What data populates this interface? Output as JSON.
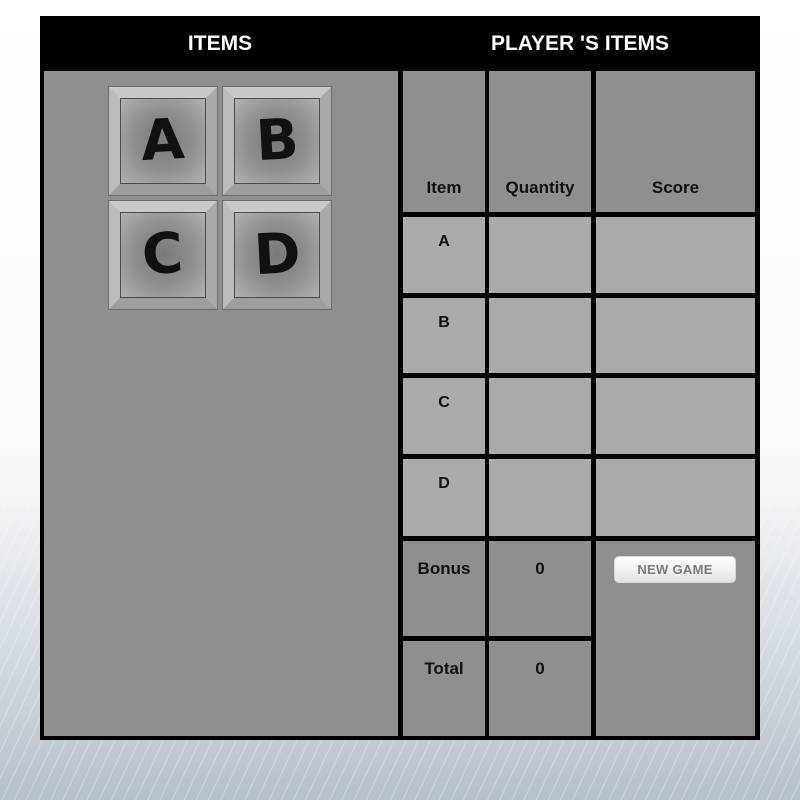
{
  "header": {
    "items_title": "ITEMS",
    "player_items_title": "PLAYER 'S ITEMS"
  },
  "items": [
    {
      "letter": "A"
    },
    {
      "letter": "B"
    },
    {
      "letter": "C"
    },
    {
      "letter": "D"
    }
  ],
  "table": {
    "columns": [
      "Item",
      "Quantity",
      "Score"
    ],
    "rows": [
      {
        "item": "A",
        "quantity": "",
        "score": ""
      },
      {
        "item": "B",
        "quantity": "",
        "score": ""
      },
      {
        "item": "C",
        "quantity": "",
        "score": ""
      },
      {
        "item": "D",
        "quantity": "",
        "score": ""
      }
    ],
    "bonus": {
      "label": "Bonus",
      "value": "0"
    },
    "total": {
      "label": "Total",
      "value": "0"
    }
  },
  "actions": {
    "new_game_label": "NEW GAME"
  },
  "colors": {
    "frame": "#000000",
    "panel": "#8f8f8f",
    "cell_light": "#ababab",
    "header_text": "#ffffff"
  }
}
